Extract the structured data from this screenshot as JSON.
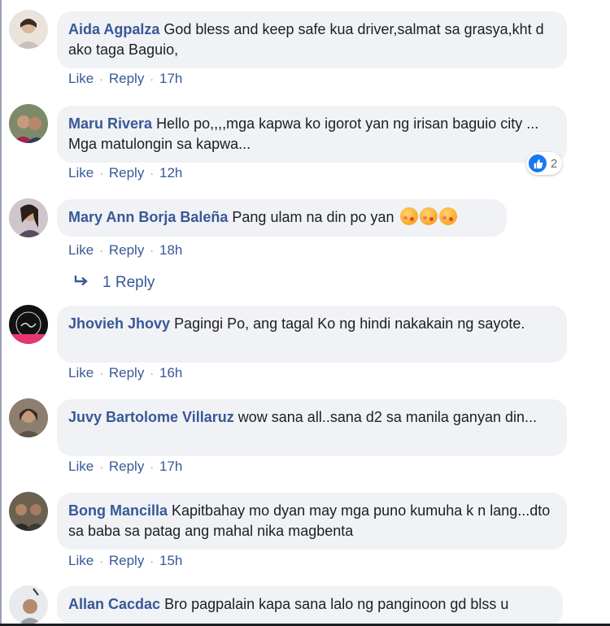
{
  "comments": [
    {
      "author": "Aida Agpalza",
      "text": "God bless and keep safe kua driver,salmat sa grasya,kht d ako taga Baguio,",
      "like": "Like",
      "reply": "Reply",
      "time": "17h"
    },
    {
      "author": "Maru Rivera",
      "text": "Hello po,,,,mga kapwa ko igorot yan ng irisan baguio city ... Mga matulongin sa kapwa...",
      "like": "Like",
      "reply": "Reply",
      "time": "12h",
      "reaction_count": "2",
      "reaction_icon": "thumbs-up-icon"
    },
    {
      "author": "Mary Ann Borja Baleña",
      "text": "Pang ulam na din po yan",
      "like": "Like",
      "reply": "Reply",
      "time": "18h",
      "emoji": "kiss-face-icon"
    },
    {
      "author": "Jhovieh Jhovy",
      "text": "Pagingi Po, ang tagal Ko ng hindi nakakain ng sayote.",
      "like": "Like",
      "reply": "Reply",
      "time": "16h"
    },
    {
      "author": "Juvy Bartolome Villaruz",
      "text": "wow sana all..sana d2 sa manila ganyan din...",
      "like": "Like",
      "reply": "Reply",
      "time": "17h"
    },
    {
      "author": "Bong Mancilla",
      "text": "Kapitbahay mo dyan may mga puno kumuha k n lang...dto sa baba sa patag ang mahal nika magbenta",
      "like": "Like",
      "reply": "Reply",
      "time": "15h"
    },
    {
      "author": "Allan Cacdac",
      "text": "Bro pagpalain kapa sana lalo ng panginoon gd blss u"
    }
  ],
  "replies_link": {
    "label": "1 Reply",
    "icon": "reply-arrow-icon"
  },
  "colors": {
    "link": "#385898",
    "bubble": "#f0f2f5",
    "like_blue": "#1877f2"
  }
}
